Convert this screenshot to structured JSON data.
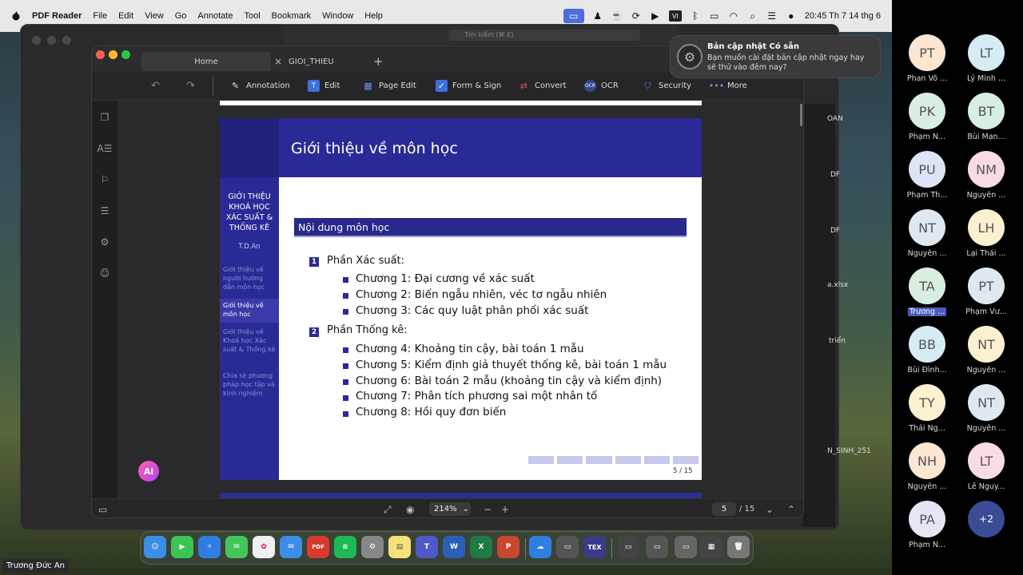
{
  "menubar": {
    "app_name": "PDF Reader",
    "items": [
      "File",
      "Edit",
      "View",
      "Go",
      "Annotate",
      "Tool",
      "Bookmark",
      "Window",
      "Help"
    ],
    "clock": "20:45 Th 7 14 thg 6"
  },
  "teams_search_placeholder": "Tìm kiếm (⌘ E)",
  "window": {
    "tabs": [
      {
        "label": "Home"
      },
      {
        "label": "GIOI_THIEU"
      }
    ],
    "toolbar": [
      {
        "label": "Annotation",
        "icon": "pen-icon"
      },
      {
        "label": "Edit",
        "icon": "edit-text-icon"
      },
      {
        "label": "Page Edit",
        "icon": "page-grid-icon"
      },
      {
        "label": "Form & Sign",
        "icon": "checkbox-icon"
      },
      {
        "label": "Convert",
        "icon": "convert-icon"
      },
      {
        "label": "OCR",
        "icon": "ocr-icon"
      },
      {
        "label": "Security",
        "icon": "shield-icon"
      },
      {
        "label": "More",
        "icon": "more-dots-icon"
      }
    ],
    "zoom": "214%",
    "page_current": "5",
    "page_total": "/ 15"
  },
  "slide": {
    "title": "Giới thiệu về môn học",
    "sidebar_title": "GIỚI THIỆU KHOÁ HỌC XÁC SUẤT & THỐNG KÊ",
    "sidebar_author": "T.D.An",
    "sidebar_items": [
      "Giới thiệu về người hướng dẫn môn học",
      "Giới thiệu về môn học",
      "Giới thiệu về Khoá học Xác suất & Thống kê",
      "Chia sẻ phương pháp học tập và kinh nghiệm"
    ],
    "block_title": "Nội dung môn học",
    "parts": [
      {
        "num": "1",
        "label": "Phần Xác suất:",
        "items": [
          "Chương 1: Đại cương về xác suất",
          "Chương 2: Biến ngẫu nhiên, véc tơ ngẫu nhiên",
          "Chương 3: Các quy luật phân phối xác suất"
        ]
      },
      {
        "num": "2",
        "label": "Phần Thống kê:",
        "items": [
          "Chương 4: Khoảng tin cậy, bài toán 1 mẫu",
          "Chương 5: Kiểm định giả thuyết thống kê, bài toán 1 mẫu",
          "Chương 6: Bài toán 2 mẫu (khoảng tin cậy và kiểm định)",
          "Chương 7: Phân tích phương sai một nhân tố",
          "Chương 8: Hồi quy đơn biến"
        ]
      }
    ],
    "page_label": "5 / 15"
  },
  "ai_label": "Ai",
  "notification": {
    "title": "Bản cập nhật Có sẵn",
    "body": "Bạn muốn cài đặt bản cập nhật ngay hay sẽ thử vào đêm nay?"
  },
  "bg_window_labels": [
    "OAN",
    "DF",
    "DF",
    "a.xlsx",
    "triển",
    "N_SINH_251"
  ],
  "presenter_name": "Trương Đức An",
  "participants": [
    {
      "initials": "PT",
      "name": "Phan Võ ...",
      "color": "#fde6d2"
    },
    {
      "initials": "LT",
      "name": "Lý Minh ...",
      "color": "#d6ecf4"
    },
    {
      "initials": "PK",
      "name": "Phạm N...",
      "color": "#d6efe0"
    },
    {
      "initials": "BT",
      "name": "Bùi Mạn...",
      "color": "#d6efe0"
    },
    {
      "initials": "PU",
      "name": "Phạm Th...",
      "color": "#dde4f6"
    },
    {
      "initials": "NM",
      "name": "Nguyễn ...",
      "color": "#f9dbe6"
    },
    {
      "initials": "NT",
      "name": "Nguyễn ...",
      "color": "#dfe8ee"
    },
    {
      "initials": "LH",
      "name": "Lại Thái ...",
      "color": "#fbf0cf"
    },
    {
      "initials": "TA",
      "name": "Trương ...",
      "color": "#d8efe0",
      "highlight": true
    },
    {
      "initials": "PT",
      "name": "Phạm Vư...",
      "color": "#dfe8ee"
    },
    {
      "initials": "BB",
      "name": "Bùi Đình...",
      "color": "#d6ecf4"
    },
    {
      "initials": "NT",
      "name": "Nguyễn ...",
      "color": "#fbf0cf"
    },
    {
      "initials": "TY",
      "name": "Thái Ng...",
      "color": "#fbf0cf"
    },
    {
      "initials": "NT",
      "name": "Nguyễn ...",
      "color": "#dfe8ee"
    },
    {
      "initials": "NH",
      "name": "Nguyễn ...",
      "color": "#fde6d2"
    },
    {
      "initials": "LT",
      "name": "Lê Nguy...",
      "color": "#f9dbe6"
    },
    {
      "initials": "PA",
      "name": "Phạm N...",
      "color": "#e4e6f3"
    },
    {
      "initials": "+2",
      "name": "",
      "color": "#3b4c96"
    }
  ]
}
